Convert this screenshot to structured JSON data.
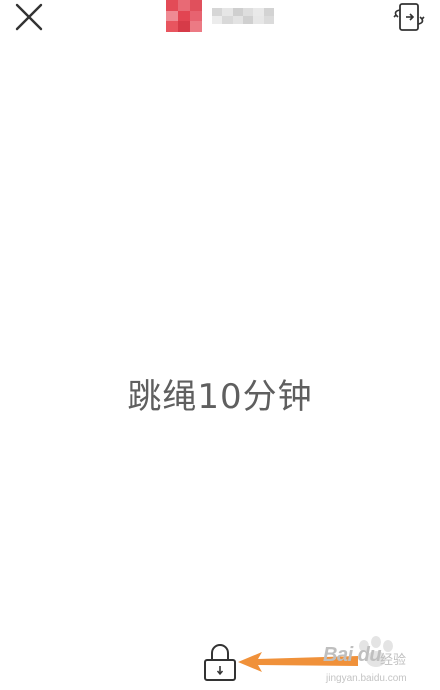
{
  "header": {
    "close_icon": "close-icon",
    "rotate_icon": "screen-rotate-icon",
    "avatar_colors": [
      "#e34b57",
      "#e86a75",
      "#e0505c",
      "#ef8a93",
      "#e24552",
      "#e76370",
      "#e8555f",
      "#d63b48",
      "#ec7a84"
    ],
    "username_colors": [
      "#d6d6d6",
      "#e6e6e6",
      "#cfcfcf",
      "#dedede",
      "#e9e9e9",
      "#d3d3d3",
      "#ececec",
      "#d9d9d9",
      "#e3e3e3",
      "#d0d0d0",
      "#e7e7e7",
      "#dbdbdb"
    ]
  },
  "main": {
    "message": "跳绳10分钟"
  },
  "footer": {
    "lock_icon": "lock-icon",
    "arrow_color": "#f0913a"
  },
  "watermark": {
    "brand": "Bai du",
    "cn_suffix": "经验",
    "url": "jingyan.baidu.com"
  },
  "colors": {
    "text": "#5f5f5f",
    "icon": "#333333",
    "accent": "#f0913a"
  }
}
